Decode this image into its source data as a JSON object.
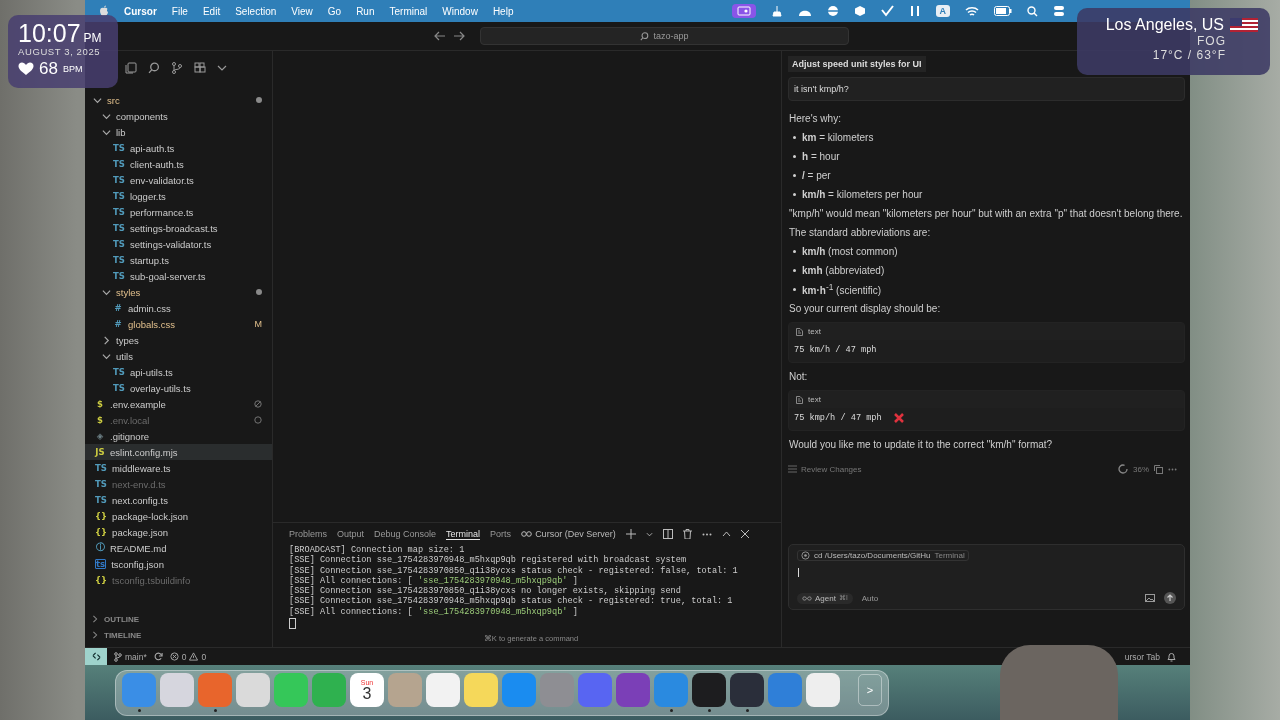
{
  "clock_widget": {
    "time": "10:07",
    "meridiem": "PM",
    "date": "AUGUST 3, 2025",
    "heart_rate": "68",
    "unit": "BPM"
  },
  "weather_widget": {
    "location": "Los Angeles, US",
    "condition": "FOG",
    "temperature": "17°C / 63°F"
  },
  "menu_bar": {
    "app": "Cursor",
    "menus": [
      "File",
      "Edit",
      "Selection",
      "View",
      "Go",
      "Run",
      "Terminal",
      "Window",
      "Help"
    ],
    "input_source": "A"
  },
  "title_bar": {
    "search": "tazo-app"
  },
  "explorer": {
    "tree": [
      {
        "name": "src",
        "kind": "folder",
        "expanded": true,
        "changed": true,
        "children": [
          {
            "name": "components",
            "kind": "folder",
            "expanded": true,
            "changed": false
          },
          {
            "name": "lib",
            "kind": "folder",
            "expanded": true,
            "changed": false,
            "children": [
              {
                "name": "api-auth.ts",
                "kind": "file",
                "badge": "TS",
                "color": "#519aba",
                "selected": false,
                "changed": false,
                "ignored": false,
                "excluded": false
              },
              {
                "name": "client-auth.ts",
                "kind": "file",
                "badge": "TS",
                "color": "#519aba",
                "selected": false,
                "changed": false,
                "ignored": false,
                "excluded": false
              },
              {
                "name": "env-validator.ts",
                "kind": "file",
                "badge": "TS",
                "color": "#519aba",
                "selected": false,
                "changed": false,
                "ignored": false,
                "excluded": false
              },
              {
                "name": "logger.ts",
                "kind": "file",
                "badge": "TS",
                "color": "#519aba",
                "selected": false,
                "changed": false,
                "ignored": false,
                "excluded": false
              },
              {
                "name": "performance.ts",
                "kind": "file",
                "badge": "TS",
                "color": "#519aba",
                "selected": false,
                "changed": false,
                "ignored": false,
                "excluded": false
              },
              {
                "name": "settings-broadcast.ts",
                "kind": "file",
                "badge": "TS",
                "color": "#519aba",
                "selected": false,
                "changed": false,
                "ignored": false,
                "excluded": false
              },
              {
                "name": "settings-validator.ts",
                "kind": "file",
                "badge": "TS",
                "color": "#519aba",
                "selected": false,
                "changed": false,
                "ignored": false,
                "excluded": false
              },
              {
                "name": "startup.ts",
                "kind": "file",
                "badge": "TS",
                "color": "#519aba",
                "selected": false,
                "changed": false,
                "ignored": false,
                "excluded": false
              },
              {
                "name": "sub-goal-server.ts",
                "kind": "file",
                "badge": "TS",
                "color": "#519aba",
                "selected": false,
                "changed": false,
                "ignored": false,
                "excluded": false
              }
            ]
          },
          {
            "name": "styles",
            "kind": "folder",
            "expanded": true,
            "changed": true,
            "children": [
              {
                "name": "admin.css",
                "kind": "file",
                "badge": "#",
                "color": "#519aba",
                "selected": false,
                "changed": false,
                "ignored": false,
                "excluded": false
              },
              {
                "name": "globals.css",
                "kind": "file",
                "badge": "#",
                "color": "#519aba",
                "selected": false,
                "changed": true,
                "ignored": false,
                "excluded": false,
                "status": "M"
              }
            ]
          },
          {
            "name": "types",
            "kind": "folder",
            "expanded": false,
            "changed": false
          },
          {
            "name": "utils",
            "kind": "folder",
            "expanded": true,
            "changed": false,
            "children": [
              {
                "name": "api-utils.ts",
                "kind": "file",
                "badge": "TS",
                "color": "#519aba",
                "selected": false,
                "changed": false,
                "ignored": false,
                "excluded": false
              },
              {
                "name": "overlay-utils.ts",
                "kind": "file",
                "badge": "TS",
                "color": "#519aba",
                "selected": false,
                "changed": false,
                "ignored": false,
                "excluded": false
              }
            ]
          }
        ]
      },
      {
        "name": ".env.example",
        "kind": "file",
        "badge": "$",
        "color": "#cbcb41",
        "selected": false,
        "changed": false,
        "ignored": false,
        "excluded": true
      },
      {
        "name": ".env.local",
        "kind": "file",
        "badge": "$",
        "color": "#cbcb41",
        "selected": false,
        "changed": false,
        "ignored": true,
        "excluded": true
      },
      {
        "name": ".gitignore",
        "kind": "file",
        "badge": "◈",
        "color": "#6d8086",
        "selected": false,
        "changed": false,
        "ignored": false,
        "excluded": false
      },
      {
        "name": "eslint.config.mjs",
        "kind": "file",
        "badge": "JS",
        "color": "#cbcb41",
        "selected": true,
        "changed": false,
        "ignored": false,
        "excluded": false
      },
      {
        "name": "middleware.ts",
        "kind": "file",
        "badge": "TS",
        "color": "#519aba",
        "selected": false,
        "changed": false,
        "ignored": false,
        "excluded": false
      },
      {
        "name": "next-env.d.ts",
        "kind": "file",
        "badge": "TS",
        "color": "#519aba",
        "selected": false,
        "changed": false,
        "ignored": true,
        "excluded": false
      },
      {
        "name": "next.config.ts",
        "kind": "file",
        "badge": "TS",
        "color": "#519aba",
        "selected": false,
        "changed": false,
        "ignored": false,
        "excluded": false
      },
      {
        "name": "package-lock.json",
        "kind": "file",
        "badge": "{}",
        "color": "#cbcb41",
        "selected": false,
        "changed": false,
        "ignored": false,
        "excluded": false
      },
      {
        "name": "package.json",
        "kind": "file",
        "badge": "{}",
        "color": "#cbcb41",
        "selected": false,
        "changed": false,
        "ignored": false,
        "excluded": false
      },
      {
        "name": "README.md",
        "kind": "file",
        "badge": "ⓘ",
        "color": "#519aba",
        "selected": false,
        "changed": false,
        "ignored": false,
        "excluded": false
      },
      {
        "name": "tsconfig.json",
        "kind": "file",
        "badge": "ts",
        "color": "#3178c6",
        "selected": false,
        "changed": false,
        "ignored": false,
        "excluded": false
      },
      {
        "name": "tsconfig.tsbuildinfo",
        "kind": "file",
        "badge": "{}",
        "color": "#cbcb41",
        "selected": false,
        "changed": false,
        "ignored": true,
        "excluded": false
      }
    ],
    "sections": [
      {
        "label": "OUTLINE",
        "expanded": false
      },
      {
        "label": "TIMELINE",
        "expanded": false
      }
    ]
  },
  "panel": {
    "tabs": [
      {
        "label": "Problems",
        "selected": false
      },
      {
        "label": "Output",
        "selected": false
      },
      {
        "label": "Debug Console",
        "selected": false
      },
      {
        "label": "Terminal",
        "selected": true
      },
      {
        "label": "Ports",
        "selected": false
      }
    ],
    "terminal_name": "Cursor (Dev Server)",
    "lines": [
      {
        "segments": [
          {
            "text": "[BROADCAST] Connection map size: 1",
            "kind": "plain"
          }
        ]
      },
      {
        "segments": [
          {
            "text": "[SSE] Connection sse_1754283970948_m5hxqp9qb registered with broadcast system",
            "kind": "plain"
          }
        ]
      },
      {
        "segments": [
          {
            "text": "[SSE] Connection sse_1754283970850_q1i38ycxs status check - registered: false, total: 1",
            "kind": "plain"
          }
        ]
      },
      {
        "segments": [
          {
            "text": "[SSE] All connections: [ ",
            "kind": "plain"
          },
          {
            "text": "'sse_1754283970948_m5hxqp9qb'",
            "kind": "string"
          },
          {
            "text": " ]",
            "kind": "plain"
          }
        ]
      },
      {
        "segments": [
          {
            "text": "[SSE] Connection sse_1754283970850_q1i38ycxs no longer exists, skipping send",
            "kind": "plain"
          }
        ]
      },
      {
        "segments": [
          {
            "text": "[SSE] Connection sse_1754283970948_m5hxqp9qb status check - registered: true, total: 1",
            "kind": "plain"
          }
        ]
      },
      {
        "segments": [
          {
            "text": "[SSE] All connections: [ ",
            "kind": "plain"
          },
          {
            "text": "'sse_1754283970948_m5hxqp9qb'",
            "kind": "string"
          },
          {
            "text": " ]",
            "kind": "plain"
          }
        ]
      }
    ],
    "hint": "⌘K to generate a command"
  },
  "chat": {
    "title": "Adjust speed unit styles for UI",
    "user_message": "it isn't kmp/h?",
    "blocks": [
      {
        "kind": "paragraph",
        "text": "Here's why:"
      },
      {
        "kind": "bullets",
        "items": [
          "**km** = kilometers",
          "**h** = hour",
          "**/** = per",
          "**km/h** = kilometers per hour"
        ]
      },
      {
        "kind": "paragraph",
        "text": "\"kmp/h\" would mean \"kilometers per hour\" but with an extra \"p\" that doesn't belong there."
      },
      {
        "kind": "paragraph",
        "text": "The standard abbreviations are:"
      },
      {
        "kind": "bullets",
        "items": [
          "**km/h** (most common)",
          "**kmh** (abbreviated)",
          "**km·h**$^{-1}$ (scientific)"
        ]
      },
      {
        "kind": "paragraph",
        "text": "So your current display should be:"
      },
      {
        "kind": "code",
        "label": "text",
        "code": "75 km/h / 47 mph",
        "wrong": false
      },
      {
        "kind": "paragraph",
        "text": "Not:"
      },
      {
        "kind": "code",
        "label": "text",
        "code": "75 kmp/h / 47 mph",
        "wrong": true
      },
      {
        "kind": "paragraph",
        "text": "Would you like me to update it to the correct \"km/h\" format?"
      }
    ],
    "review": "Review Changes",
    "progress": "36%",
    "context": "cd /Users/tazo/Documents/GitHu",
    "context_kind": "Terminal",
    "mode": "Agent",
    "mode_shortcut": "⌘I",
    "model": "Auto"
  },
  "status_bar": {
    "branch": "main*",
    "errors": "0",
    "warnings": "0",
    "right_label": "ursor Tab"
  },
  "dock": [
    {
      "kind": "app",
      "color": "#3a8ee6",
      "running": true
    },
    {
      "kind": "app",
      "color": "#d6d6de",
      "running": false
    },
    {
      "kind": "app",
      "color": "#e8652c",
      "running": true
    },
    {
      "kind": "app",
      "color": "#dadada",
      "running": false
    },
    {
      "kind": "app",
      "color": "#35c759",
      "running": false
    },
    {
      "kind": "app",
      "color": "#2fb14f",
      "running": false
    },
    {
      "kind": "calendar",
      "weekday": "Sun",
      "day": "3",
      "running": false
    },
    {
      "kind": "app",
      "color": "#b5a48f",
      "running": false
    },
    {
      "kind": "app",
      "color": "#f2f2f2",
      "running": false
    },
    {
      "kind": "app",
      "color": "#f5d85a",
      "running": false
    },
    {
      "kind": "app",
      "color": "#1a8cf0",
      "running": false
    },
    {
      "kind": "app",
      "color": "#8e8e93",
      "running": false
    },
    {
      "kind": "app",
      "color": "#5865f2",
      "running": false
    },
    {
      "kind": "app",
      "color": "#7b3fb7",
      "running": false
    },
    {
      "kind": "app",
      "color": "#2a8ae0",
      "running": true
    },
    {
      "kind": "app",
      "color": "#1d1d1f",
      "running": true
    },
    {
      "kind": "app",
      "color": "#2a2e3a",
      "running": true
    },
    {
      "kind": "app",
      "color": "#2f7fd8",
      "running": false
    },
    {
      "kind": "app",
      "color": "#eeeeee",
      "running": false
    },
    {
      "kind": "more",
      "label": ">",
      "running": false
    }
  ]
}
